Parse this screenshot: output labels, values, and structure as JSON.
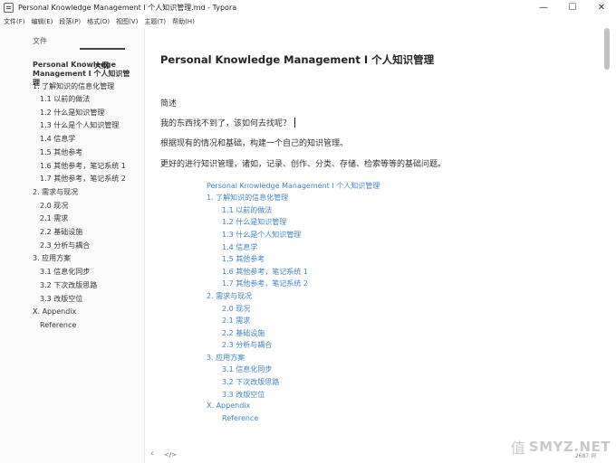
{
  "window": {
    "title": "Personal Knowledge Management I 个人知识管理.md - Typora",
    "controls": [
      "—",
      "☐",
      "✕"
    ]
  },
  "menu": [
    "文件(F)",
    "编辑(E)",
    "段落(P)",
    "格式(O)",
    "视图(V)",
    "主题(T)",
    "帮助(H)"
  ],
  "sidebar": {
    "tabs": {
      "files": "文件",
      "outline": "大纲"
    },
    "outline_title": "Personal Knowledge Management I 个人知识管理",
    "items": [
      "1. 了解知识的信息化管理",
      "1.1 以前的做法",
      "1.2 什么是知识管理",
      "1.3 什么是个人知识管理",
      "1.4 信息学",
      "1.5 其他参考",
      "1.6 其他参考，笔记系统 1",
      "1.7 其他参考，笔记系统 2",
      "2. 需求与现况",
      "2.0 现况",
      "2.1 需求",
      "2.2 基础设施",
      "2.3 分析与耦合",
      "3. 应用方案",
      "3.1 信息化同步",
      "3.2 下次改版思路",
      "3.3 改版空位",
      "X. Appendix",
      "Reference"
    ]
  },
  "editor": {
    "title": "Personal Knowledge Management I 个人知识管理",
    "paragraphs": [
      "简述",
      "我的东西找不到了，该如何去找呢？",
      "根据现有的情况和基础，构建一个自己的知识管理。",
      "更好的进行知识管理，诸如，记录、创作、分类、存储、检索等等的基础问题。"
    ],
    "toc": [
      "Personal Knowledge Management I 个人知识管理",
      "1. 了解知识的信息化管理",
      "1.1 以前的做法",
      "1.2 什么是知识管理",
      "1.3 什么是个人知识管理",
      "1.4 信息学",
      "1.5 其他参考",
      "1.6 其他参考，笔记系统 1",
      "1.7 其他参考，笔记系统 2",
      "2. 需求与现况",
      "2.0 现况",
      "2.1 需求",
      "2.2 基础设施",
      "2.3 分析与耦合",
      "3. 应用方案",
      "3.1 信息化同步",
      "3.2 下次改版思路",
      "3.3 改版空位",
      "X. Appendix",
      "Reference"
    ]
  },
  "footer": {
    "prev": "‹",
    "source": "</>",
    "word_count": "2687 词"
  },
  "watermark": {
    "icon": "值",
    "text": "SMYZ.NET"
  }
}
